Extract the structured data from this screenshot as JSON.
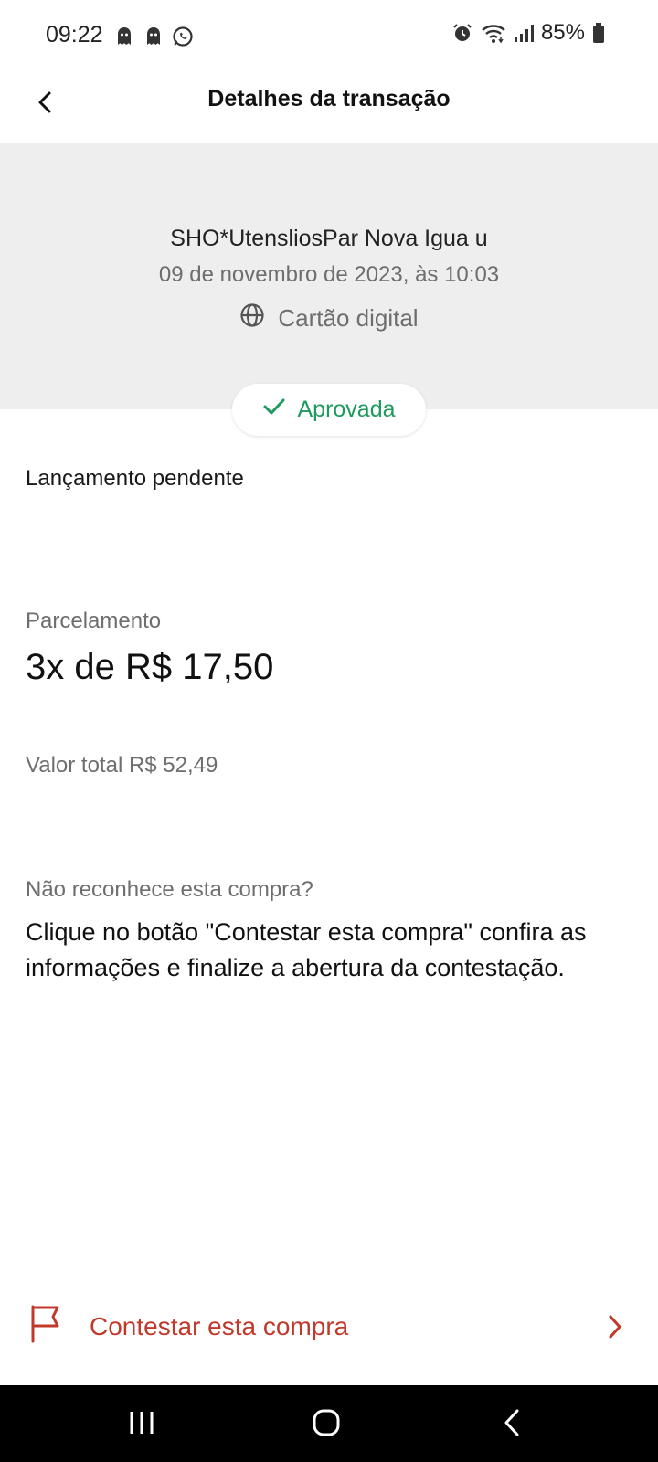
{
  "status_bar": {
    "time": "09:22",
    "battery": "85%"
  },
  "header": {
    "title": "Detalhes da transação"
  },
  "transaction": {
    "merchant": "SHO*UtensliosPar Nova Igua u",
    "datetime": "09 de novembro de 2023, às 10:03",
    "card_type": "Cartão digital",
    "status": "Aprovada",
    "status_color": "#1f9a5f",
    "pending_label": "Lançamento pendente"
  },
  "installments": {
    "label": "Parcelamento",
    "value": "3x de R$ 17,50",
    "total": "Valor total R$ 52,49"
  },
  "dispute": {
    "question": "Não reconhece esta compra?",
    "description": "Clique no botão \"Contestar esta compra\" confira as informações e finalize a abertura da contestação.",
    "button_label": "Contestar esta compra",
    "accent_color": "#c0392b"
  },
  "icons": [
    "ghost-icon",
    "ghost-icon",
    "whatsapp-icon",
    "alarm-icon",
    "wifi-icon",
    "signal-icon",
    "battery-icon",
    "back-arrow-icon",
    "globe-icon",
    "check-icon",
    "flag-icon",
    "chevron-right-icon",
    "recent-apps-icon",
    "home-icon",
    "nav-back-icon"
  ]
}
